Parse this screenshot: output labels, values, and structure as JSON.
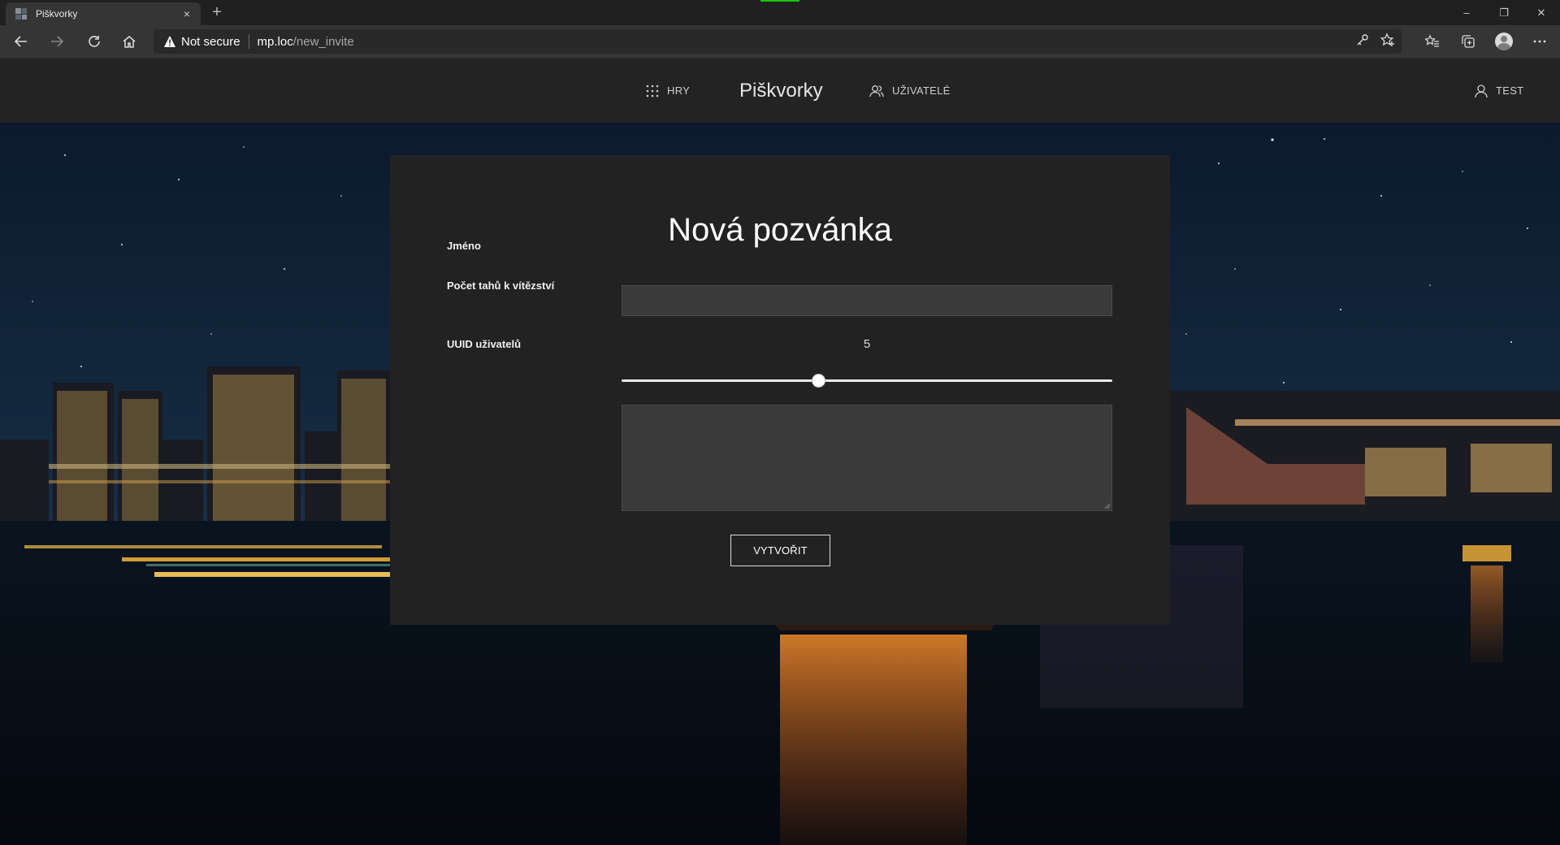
{
  "browser": {
    "tab_title": "Piškvorky",
    "tab_close": "×",
    "new_tab": "+",
    "security_label": "Not secure",
    "url_host": "mp.loc",
    "url_path": "/new_invite",
    "window_controls": [
      "–",
      "❐",
      "✕"
    ]
  },
  "header": {
    "games_label": "HRY",
    "brand": "Piškvorky",
    "users_label": "UŽIVATELÉ",
    "account_label": "TEST"
  },
  "form": {
    "title": "Nová pozvánka",
    "name_label": "Jméno",
    "name_value": "",
    "moves_label": "Počet tahů k vítězství",
    "moves_value": "5",
    "moves_slider_fraction": 0.4,
    "uuid_label": "UUID uživatelů",
    "uuid_value": "",
    "submit_label": "VYTVOŘIT"
  },
  "colors": {
    "card_bg": "#222222",
    "header_bg": "#232323",
    "input_bg": "#3a3a3a"
  }
}
